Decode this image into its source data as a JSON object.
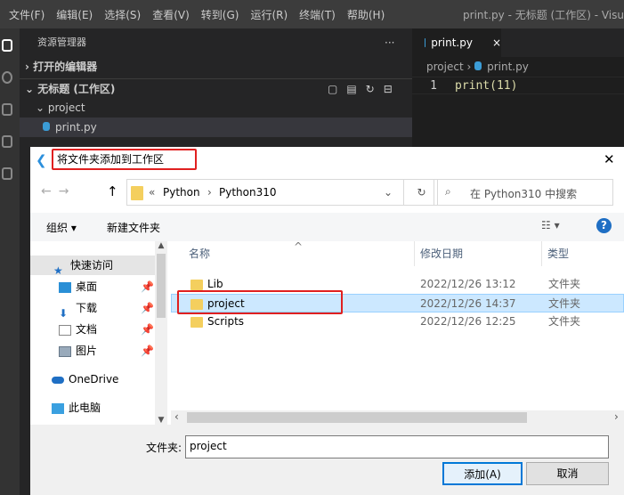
{
  "menubar": {
    "items": [
      "文件(F)",
      "编辑(E)",
      "选择(S)",
      "查看(V)",
      "转到(G)",
      "运行(R)",
      "终端(T)",
      "帮助(H)"
    ],
    "window_title": "print.py - 无标题 (工作区) - Visu"
  },
  "sidebar": {
    "title": "资源管理器",
    "more": "···",
    "open_editors": "打开的编辑器",
    "workspace": "无标题 (工作区)",
    "folder": "project",
    "file": "print.py"
  },
  "editor": {
    "tab": "print.py",
    "close": "×",
    "breadcrumb_folder": "project",
    "breadcrumb_file": "print.py",
    "line_number": "1",
    "code": "print(11)"
  },
  "dialog": {
    "title": "将文件夹添加到工作区",
    "close": "✕",
    "path": [
      "Python",
      "Python310"
    ],
    "path_prefix": "«",
    "search_placeholder": "在 Python310 中搜索",
    "organize": "组织 ▾",
    "new_folder": "新建文件夹",
    "help": "?",
    "nav": [
      {
        "label": "快速访问",
        "icon": "star-icon"
      },
      {
        "label": "桌面",
        "icon": "desktop-icon",
        "pinned": true
      },
      {
        "label": "下载",
        "icon": "download-icon",
        "pinned": true
      },
      {
        "label": "文档",
        "icon": "document-icon",
        "pinned": true
      },
      {
        "label": "图片",
        "icon": "pictures-icon",
        "pinned": true
      },
      {
        "label": "OneDrive",
        "icon": "cloud-icon"
      },
      {
        "label": "此电脑",
        "icon": "computer-icon"
      }
    ],
    "columns": [
      "名称",
      "修改日期",
      "类型"
    ],
    "files": [
      {
        "name": "Lib",
        "date": "2022/12/26 13:12",
        "type": "文件夹"
      },
      {
        "name": "project",
        "date": "2022/12/26 14:37",
        "type": "文件夹",
        "selected": true
      },
      {
        "name": "Scripts",
        "date": "2022/12/26 12:25",
        "type": "文件夹"
      }
    ],
    "folder_label": "文件夹:",
    "folder_value": "project",
    "add_button": "添加(A)",
    "cancel_button": "取消"
  },
  "colors": {
    "highlight": "#e02020",
    "selected_row": "#cce8ff",
    "accent": "#0078d7"
  }
}
